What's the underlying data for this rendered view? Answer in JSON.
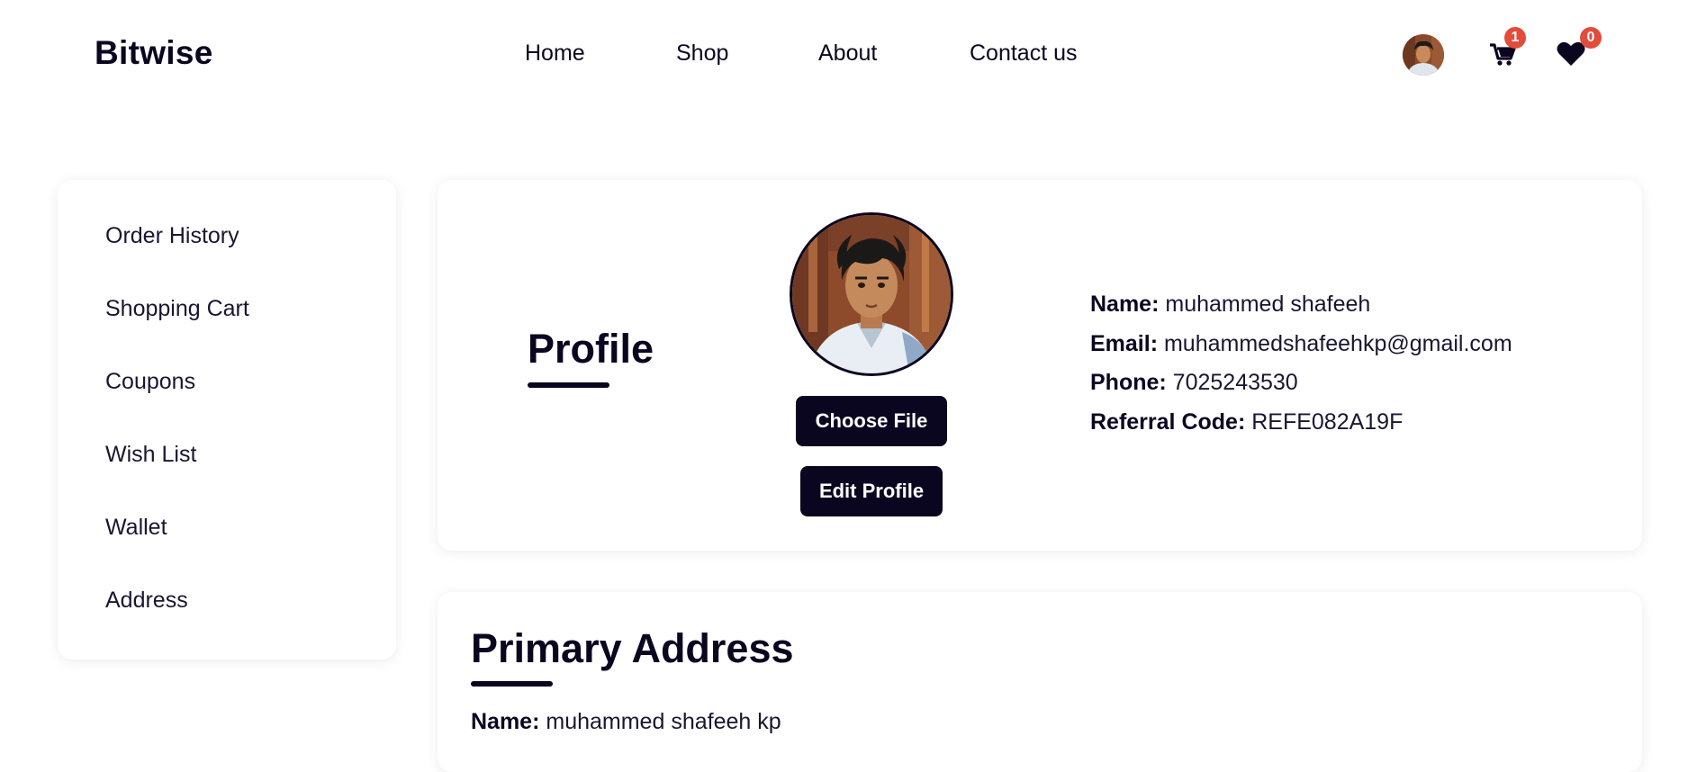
{
  "header": {
    "brand": "Bitwise",
    "nav": {
      "home": "Home",
      "shop": "Shop",
      "about": "About",
      "contact": "Contact us"
    },
    "cart_count": "1",
    "wishlist_count": "0"
  },
  "sidebar": {
    "items": [
      {
        "label": "Order History"
      },
      {
        "label": "Shopping Cart"
      },
      {
        "label": "Coupons"
      },
      {
        "label": "Wish List"
      },
      {
        "label": "Wallet"
      },
      {
        "label": "Address"
      }
    ]
  },
  "profile": {
    "title": "Profile",
    "choose_file_label": "Choose File",
    "edit_profile_label": "Edit Profile",
    "fields": {
      "name_label": "Name:",
      "name_value": "muhammed shafeeh",
      "email_label": "Email:",
      "email_value": "muhammedshafeehkp@gmail.com",
      "phone_label": "Phone:",
      "phone_value": "7025243530",
      "referral_label": "Referral Code:",
      "referral_value": "REFE082A19F"
    }
  },
  "primary_address": {
    "title": "Primary Address",
    "name_label": "Name:",
    "name_value": "muhammed shafeeh kp"
  },
  "colors": {
    "primary": "#0b0620",
    "badge": "#e24c3b",
    "background": "#ffffff"
  }
}
